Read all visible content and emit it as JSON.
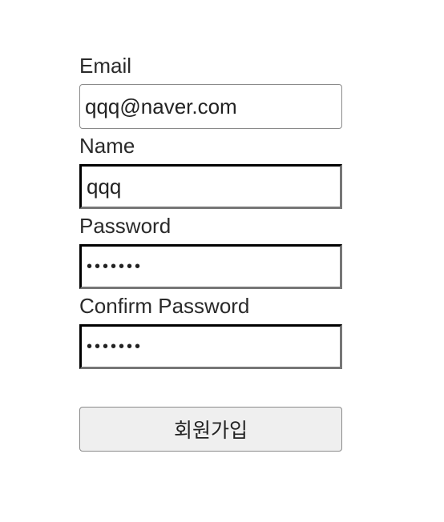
{
  "form": {
    "email": {
      "label": "Email",
      "value": "qqq@naver.com"
    },
    "name": {
      "label": "Name",
      "value": "qqq"
    },
    "password": {
      "label": "Password",
      "value": "•••••••"
    },
    "confirm_password": {
      "label": "Confirm Password",
      "value": "•••••••"
    },
    "submit_label": "회원가입"
  }
}
